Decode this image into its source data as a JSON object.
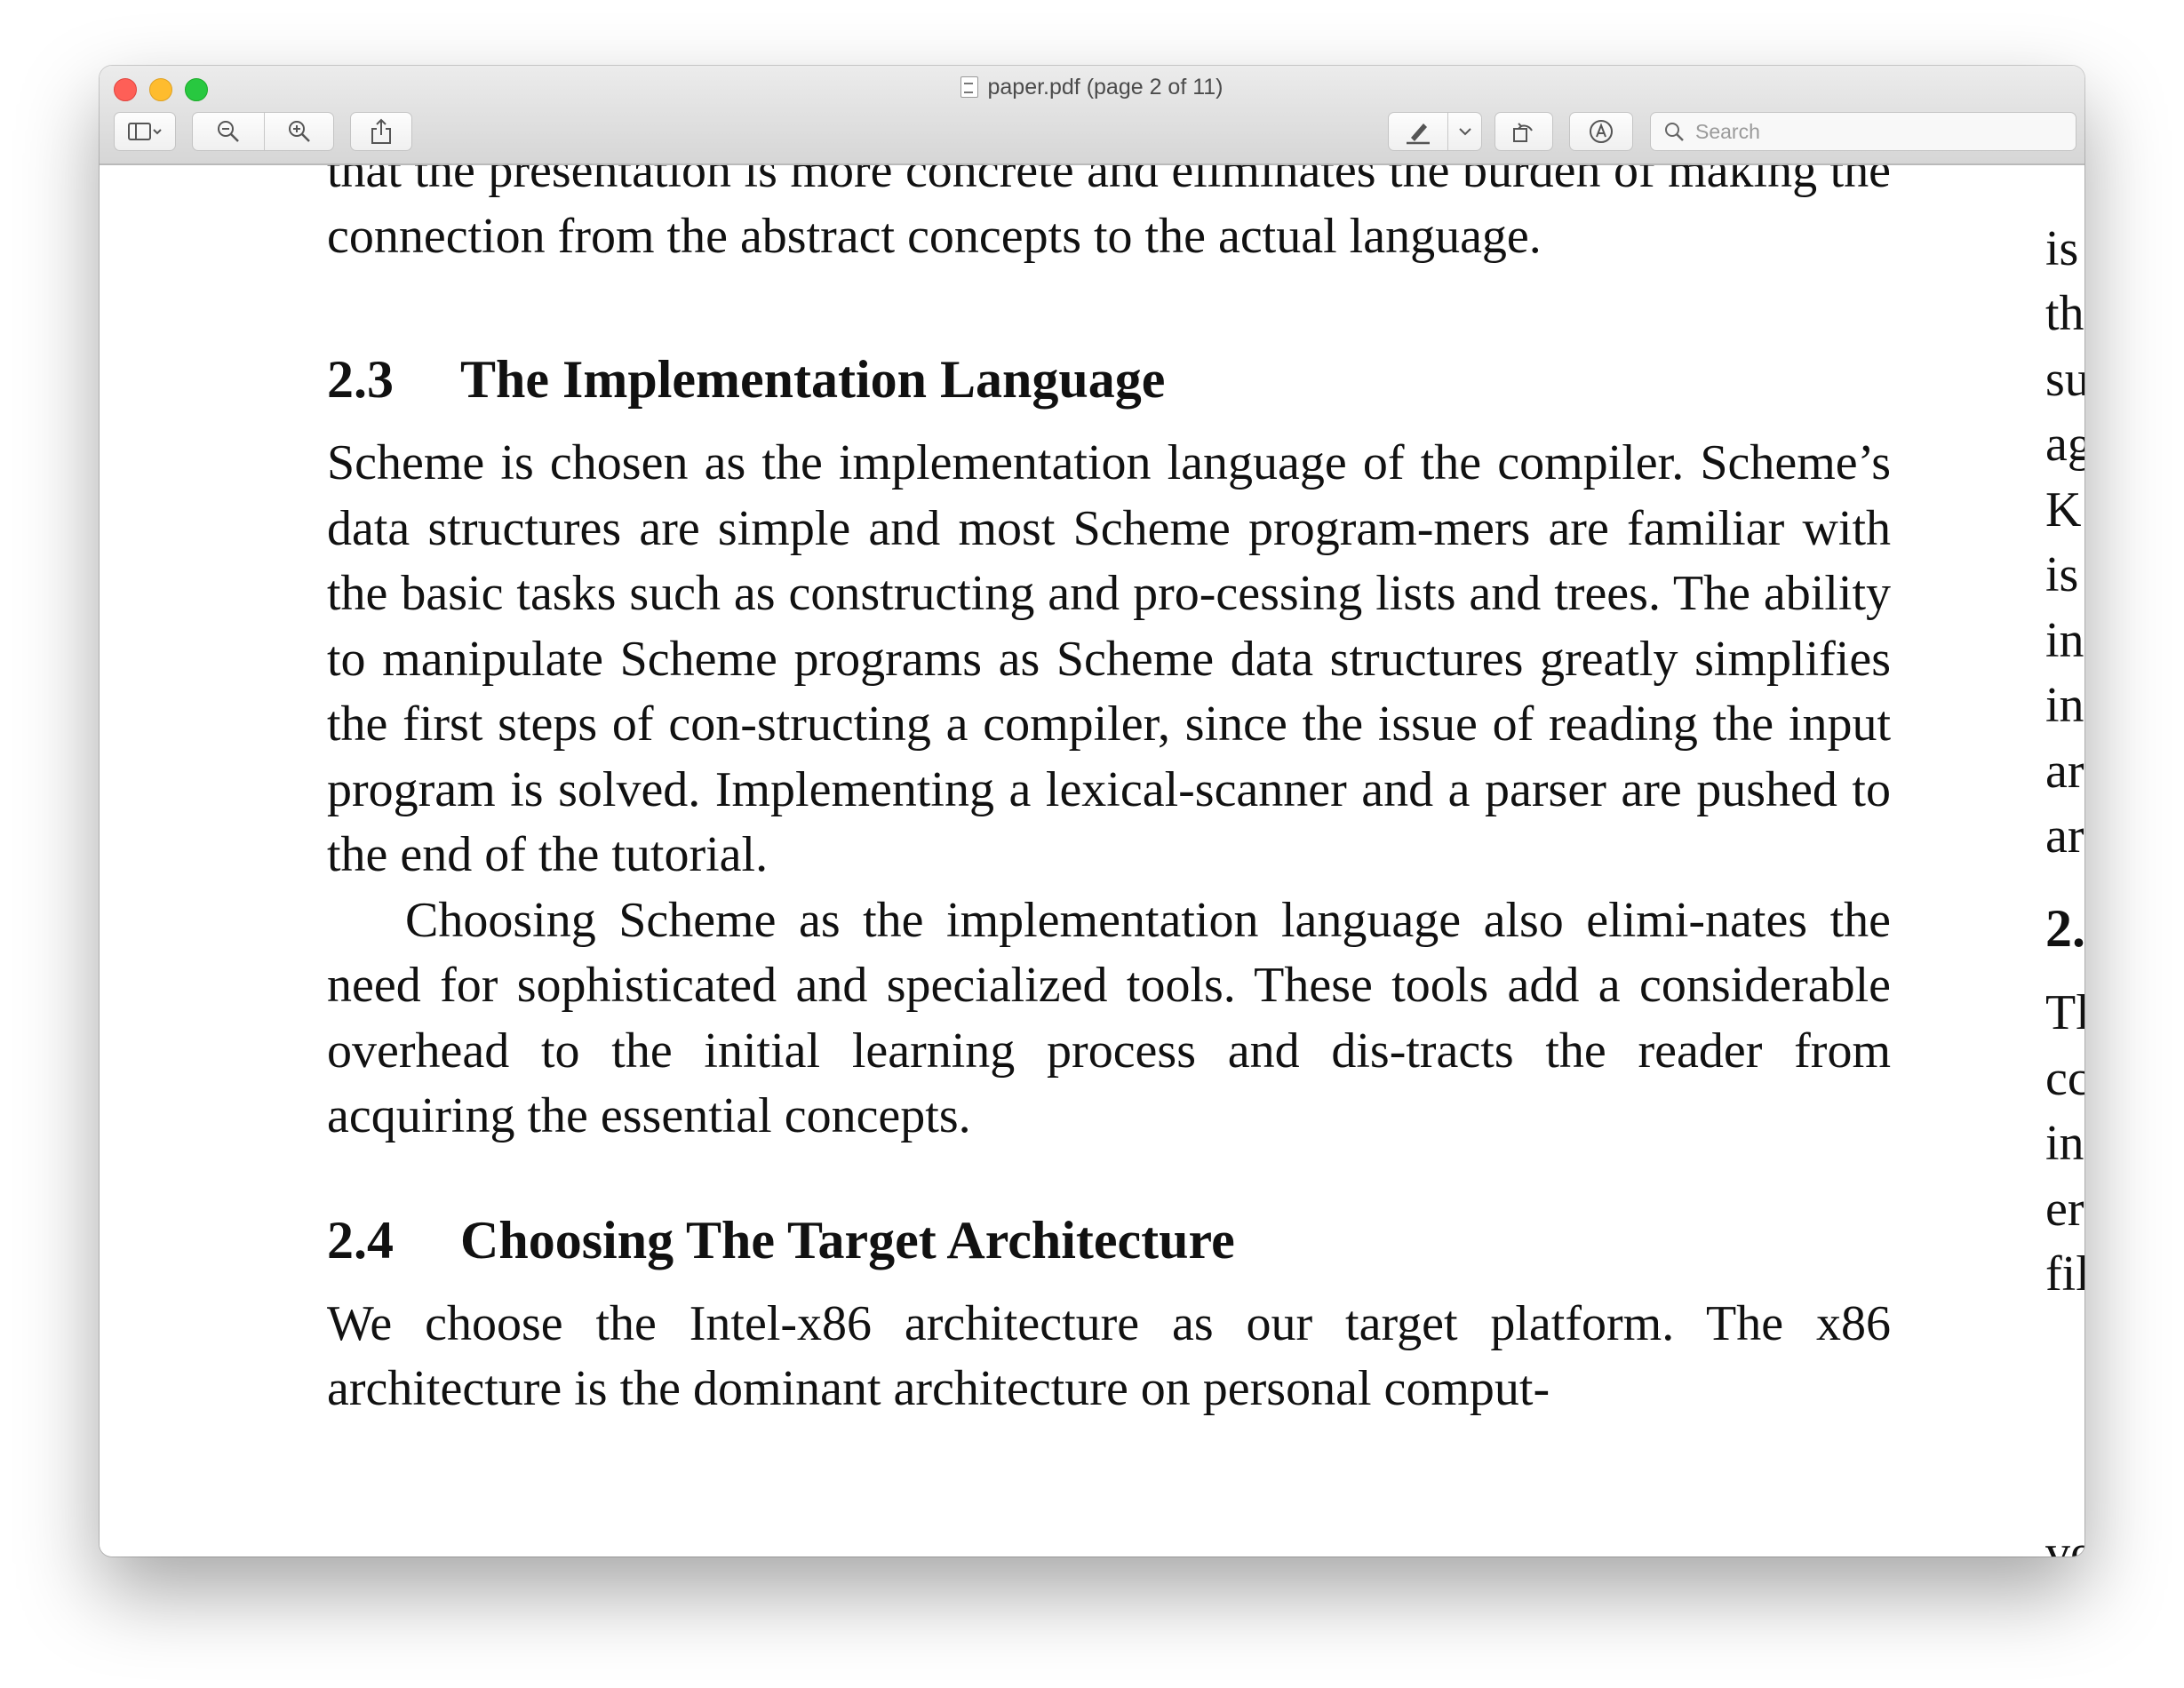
{
  "window": {
    "title": "paper.pdf (page 2 of 11)"
  },
  "toolbar": {
    "sidebar_button": "sidebar-toggle",
    "zoom_out": "zoom-out",
    "zoom_in": "zoom-in",
    "share": "share",
    "markup": "markup-pen",
    "rotate": "rotate",
    "annotate": "annotate",
    "search_placeholder": "Search"
  },
  "document": {
    "top_lines": [
      "that the presentation is more concrete and eliminates the burden",
      "of making the connection from the abstract concepts to the actual language."
    ],
    "section_2_3": {
      "number": "2.3",
      "title": "The Implementation Language"
    },
    "para_2_3_a": "Scheme is chosen as the implementation language of the compiler. Scheme’s data structures are simple and most Scheme program-mers are familiar with the basic tasks such as constructing and pro-cessing lists and trees. The ability to manipulate Scheme programs as Scheme data structures greatly simplifies the first steps of con-structing a compiler, since the issue of reading the input program is solved. Implementing a lexical-scanner and a parser are pushed to the end of the tutorial.",
    "para_2_3_b": "Choosing Scheme as the implementation language also elimi-nates the need for sophisticated and specialized tools. These tools add a considerable overhead to the initial learning process and dis-tracts the reader from acquiring the essential concepts.",
    "section_2_4": {
      "number": "2.4",
      "title": "Choosing The Target Architecture"
    },
    "para_2_4": "We choose the Intel-x86 architecture as our target platform. The x86 architecture is the dominant architecture on personal comput-",
    "right_column_fragments": [
      "is",
      "th",
      "su",
      "ag",
      "K",
      "is",
      "in",
      "in",
      "ar",
      "ar",
      "2.",
      "Tl",
      "cc",
      "in",
      "er",
      "fil",
      "ve"
    ]
  }
}
